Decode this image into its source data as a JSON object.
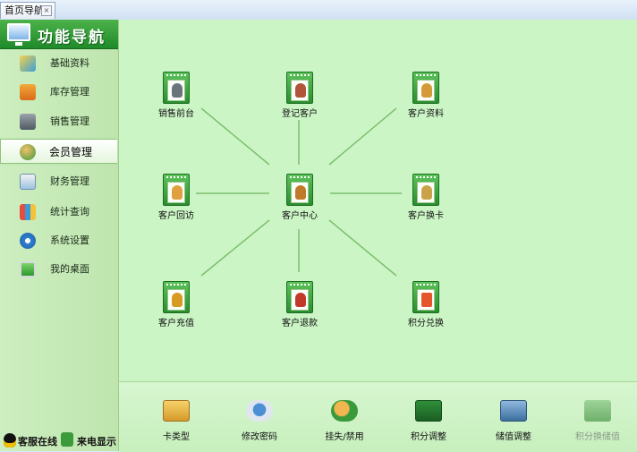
{
  "tab": {
    "label": "首页导航",
    "close_symbol": "×"
  },
  "sidebar": {
    "title": "功能导航",
    "items": [
      {
        "label": "基础资料",
        "icon": "pencil-icon",
        "active": false
      },
      {
        "label": "库存管理",
        "icon": "cart-icon",
        "active": false
      },
      {
        "label": "销售管理",
        "icon": "cash-register-icon",
        "active": false
      },
      {
        "label": "会员管理",
        "icon": "members-icon",
        "active": true
      },
      {
        "label": "财务管理",
        "icon": "finance-chart-icon",
        "active": false
      },
      {
        "label": "统计查询",
        "icon": "statistics-icon",
        "active": false
      },
      {
        "label": "系统设置",
        "icon": "gears-icon",
        "active": false
      },
      {
        "label": "我的桌面",
        "icon": "desktop-monitor-icon",
        "active": false
      }
    ]
  },
  "status": {
    "qq_label": "客服在线",
    "phone_label": "来电显示"
  },
  "diagram": {
    "center": {
      "label": "客户中心",
      "icon": "customer-center-icon"
    },
    "nodes": [
      {
        "label": "销售前台",
        "icon": "sales-counter-icon"
      },
      {
        "label": "登记客户",
        "icon": "register-customer-icon"
      },
      {
        "label": "客户资料",
        "icon": "customer-profile-icon"
      },
      {
        "label": "客户回访",
        "icon": "customer-visit-icon"
      },
      {
        "label": "客户换卡",
        "icon": "customer-card-change-icon"
      },
      {
        "label": "客户充值",
        "icon": "customer-recharge-icon"
      },
      {
        "label": "客户退款",
        "icon": "customer-refund-icon"
      },
      {
        "label": "积分兑换",
        "icon": "points-exchange-icon"
      }
    ]
  },
  "toolbar": {
    "items": [
      {
        "label": "卡类型",
        "icon": "card-type-icon",
        "enabled": true
      },
      {
        "label": "修改密码",
        "icon": "change-password-icon",
        "enabled": true
      },
      {
        "label": "挂失/禁用",
        "icon": "report-loss-icon",
        "enabled": true
      },
      {
        "label": "积分调整",
        "icon": "points-adjust-calculator-icon",
        "enabled": true
      },
      {
        "label": "储值调整",
        "icon": "balance-adjust-icon",
        "enabled": true
      },
      {
        "label": "积分换储值",
        "icon": "points-to-balance-icon",
        "enabled": false
      }
    ]
  },
  "colors": {
    "header_green": "#1f8a2a",
    "panel_green": "#ccf5c6",
    "line_green": "#7cbf6e"
  }
}
